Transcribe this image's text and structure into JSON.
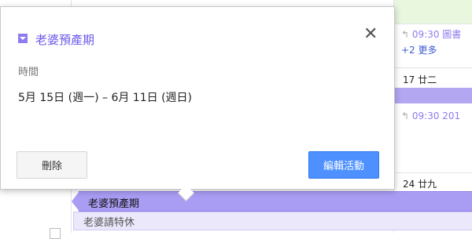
{
  "calendar": {
    "right_column": {
      "event_1": "09:30 圖書",
      "more_link": "+2 更多",
      "day_17": "17 廿二",
      "event_2": "09:30 201",
      "day_24": "24 廿九"
    },
    "event_bar": {
      "label": "老婆預產期"
    },
    "leave_bar": {
      "label": "老婆請特休"
    },
    "colors": {
      "event": "#a99cf3",
      "primary": "#4d90fe"
    }
  },
  "popup": {
    "title": "老婆預產期",
    "time_label": "時間",
    "date_range": "5月 15日 (週一) – 6月 11日 (週日)",
    "delete_label": "刪除",
    "edit_label": "編輯活動"
  },
  "icons": {
    "close": "close-icon",
    "reply": "reply-icon",
    "dropdown": "dropdown-icon"
  }
}
